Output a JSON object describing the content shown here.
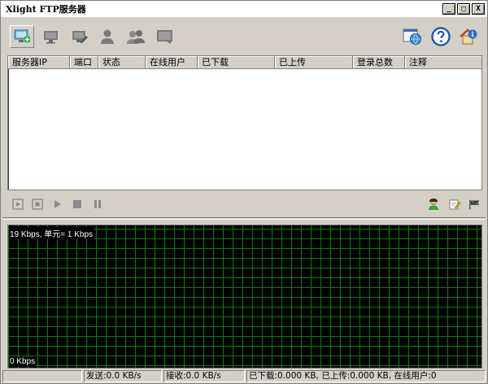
{
  "window": {
    "title": "Xlight FTP服务器",
    "buttons": {
      "minimize": "_",
      "maximize": "□",
      "close": "X"
    }
  },
  "toolbar": {
    "left_icons": [
      "add-server-icon",
      "server-icon",
      "server-edit-icon",
      "user-icon",
      "users-icon",
      "log-window-icon"
    ],
    "right_icons": [
      "globe-window-icon",
      "help-icon",
      "home-info-icon"
    ]
  },
  "table": {
    "columns": [
      "服务器IP",
      "端口",
      "状态",
      "在线用户",
      "已下载",
      "已上传",
      "登录总数",
      "注释"
    ],
    "rows": []
  },
  "controls": {
    "left_icons": [
      "start-icon",
      "stop-square-icon",
      "play-icon",
      "stop-icon",
      "pause-icon"
    ],
    "right_icons": [
      "user-green-icon",
      "edit-note-icon",
      "flag-icon"
    ]
  },
  "graph": {
    "top_label": "19 Kbps, 单元= 1 Kbps",
    "bottom_label": "0 Kbps"
  },
  "status": {
    "send": "发送:0.0 KB/s",
    "receive": "接收:0.0 KB/s",
    "summary": "已下载:0.000 KB, 已上传:0.000 KB, 在线用户:0"
  }
}
